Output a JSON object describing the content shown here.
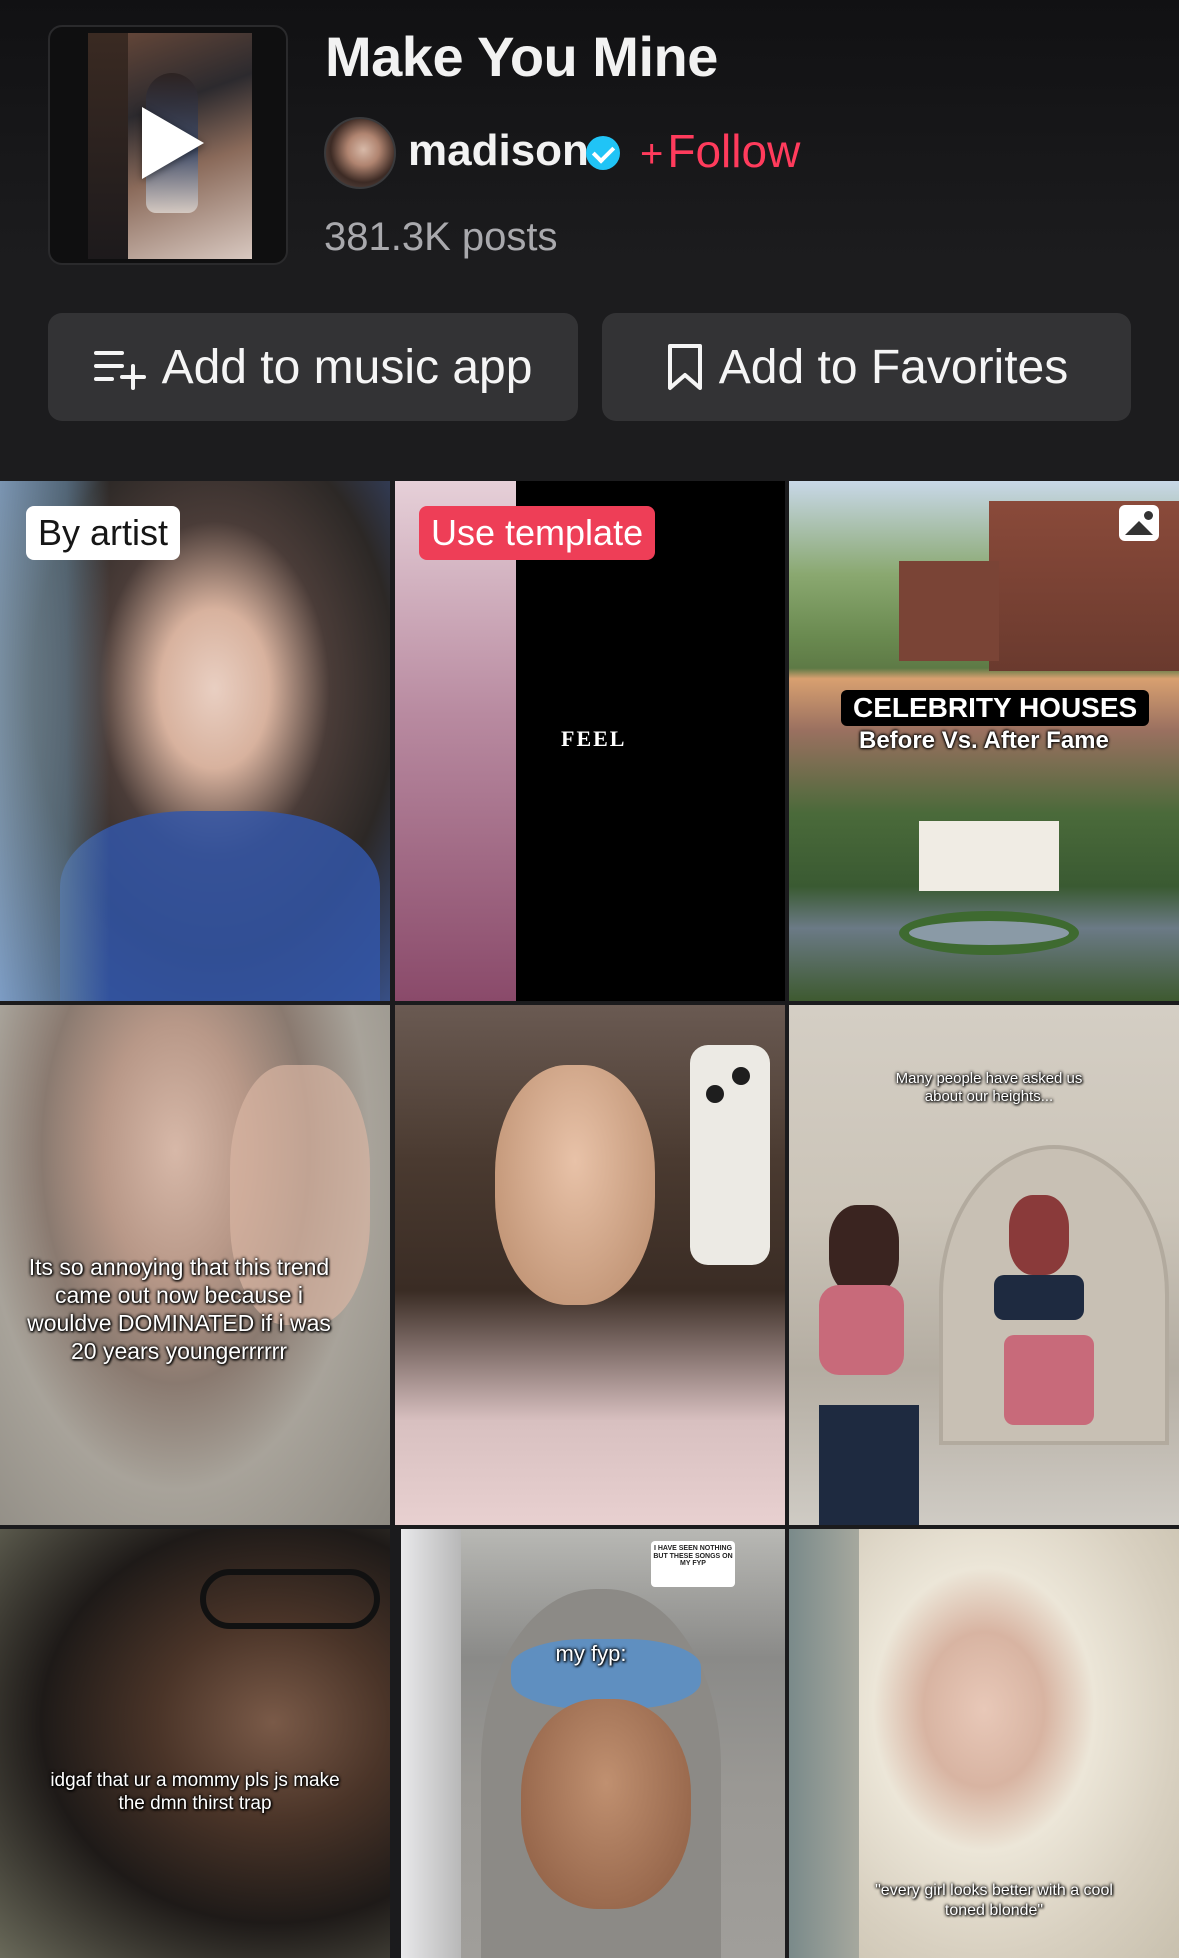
{
  "song": {
    "title": "Make You Mine",
    "artist": "madison",
    "verified": true,
    "follow_label": "Follow",
    "follow_plus": "+",
    "posts": "381.3K posts"
  },
  "actions": {
    "add_music_label": "Add to music app",
    "add_favorites_label": "Add to Favorites"
  },
  "grid": {
    "tiles": [
      {
        "badge": "By artist",
        "text": ""
      },
      {
        "badge": "Use template",
        "text": "FEEL"
      },
      {
        "label": "CELEBRITY HOUSES",
        "subtitle": "Before Vs. After Fame"
      },
      {
        "text": "Its so annoying that this trend came out now because i wouldve DOMINATED if i was 20 years youngerrrrrr"
      },
      {
        "text": ""
      },
      {
        "text": "Many people have asked us about our heights..."
      },
      {
        "text": "idgaf that ur a mommy pls js make the dmn thirst trap"
      },
      {
        "text": "my fyp:",
        "card": "I HAVE SEEN NOTHING BUT THESE SONGS ON MY FYP"
      },
      {
        "text": "\"every girl looks better with a cool toned blonde\""
      }
    ]
  },
  "colors": {
    "accent": "#ff3b5c",
    "verified": "#20c4f6",
    "button_bg": "#333335",
    "template_badge": "#ee3e57"
  },
  "icons": [
    "play-icon",
    "verified-icon",
    "playlist-add-icon",
    "bookmark-icon",
    "image-icon"
  ]
}
